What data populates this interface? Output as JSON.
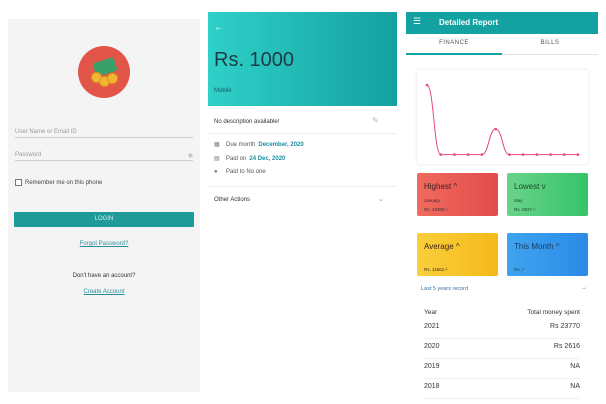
{
  "login": {
    "username_placeholder": "User Name or Email ID",
    "password_placeholder": "Password",
    "remember_label": "Remember me on this phone",
    "login_button": "LOGIN",
    "forgot_link": "Forgot Password?",
    "no_account_text": "Don't have an account?",
    "create_link": "Create Account"
  },
  "detail": {
    "amount": "Rs. 1000",
    "category": "Mobile",
    "description": "No description available!",
    "due_label": "Due month",
    "due_value": "December, 2020",
    "paid_label": "Paid on",
    "paid_value": "24 Dec, 2020",
    "paid_to": "Paid to No one",
    "other_actions": "Other Actions",
    "header_colors": [
      "#2fd0c8",
      "#14a0a0"
    ]
  },
  "report": {
    "title": "Detailed Report",
    "tabs": [
      "FINANCE",
      "BILLS"
    ],
    "stats": {
      "highest": {
        "title": "Highest ^",
        "sub": "January",
        "value": "Rs. 10300 /-"
      },
      "lowest": {
        "title": "Lowest v",
        "sub": "May",
        "value": "Rs. 0837 /-"
      },
      "average": {
        "title": "Average ^",
        "sub": "",
        "value": "Rs. 11862 /-"
      },
      "this_month": {
        "title": "This Month ^",
        "sub": "",
        "value": "Rs. /-"
      }
    },
    "last5_label": "Last 5 years record",
    "last5_arrow": "→",
    "table": {
      "headers": [
        "Year",
        "Total money spent"
      ],
      "rows": [
        [
          "2021",
          "Rs 23770"
        ],
        [
          "2020",
          "Rs 2616"
        ],
        [
          "2019",
          "NA"
        ],
        [
          "2018",
          "NA"
        ]
      ]
    },
    "accent_color": "#13a1a1",
    "chart_data": {
      "type": "line",
      "x": [
        1,
        2,
        3,
        4,
        5,
        6,
        7,
        8,
        9,
        10,
        11,
        12
      ],
      "series": [
        {
          "values": [
            100,
            2,
            2,
            2,
            2,
            38,
            2,
            2,
            2,
            2,
            2,
            2
          ]
        }
      ],
      "ylim": [
        0,
        110
      ],
      "grid": false,
      "color": "#e8467a"
    }
  }
}
